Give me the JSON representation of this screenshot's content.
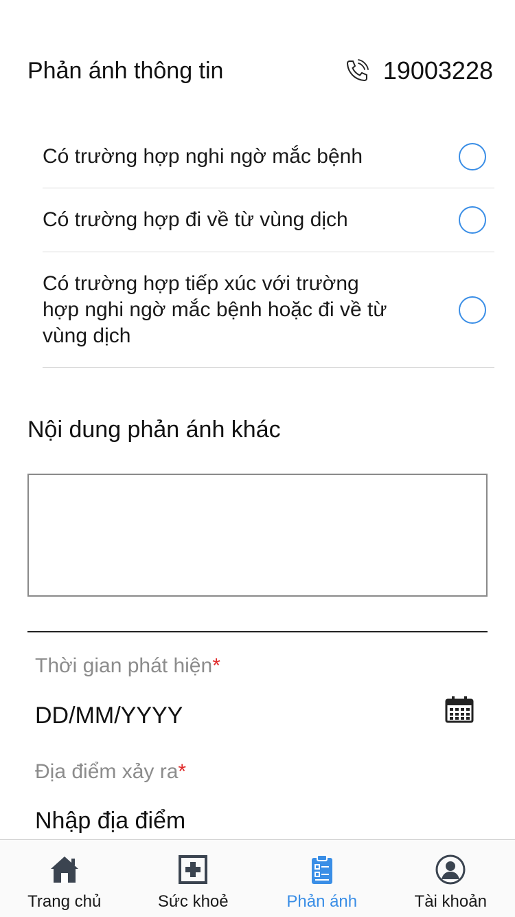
{
  "header": {
    "title": "Phản ánh thông tin",
    "hotline": "19003228",
    "hotline_icon": "phone-icon"
  },
  "options": [
    {
      "label": "Có trường hợp nghi ngờ mắc bệnh",
      "selected": false
    },
    {
      "label": "Có trường hợp đi về từ vùng dịch",
      "selected": false
    },
    {
      "label": "Có trường hợp tiếp xúc với trường hợp nghi ngờ mắc bệnh hoặc đi về từ vùng dịch",
      "selected": false
    }
  ],
  "other_content": {
    "title": "Nội dung phản ánh khác",
    "value": ""
  },
  "detection_time": {
    "label": "Thời gian phát hiện",
    "required_mark": "*",
    "value": "DD/MM/YYYY",
    "icon": "calendar-icon"
  },
  "location": {
    "label": "Địa điểm xảy ra",
    "required_mark": "*",
    "value": "Nhập địa điểm"
  },
  "tabbar": {
    "active_color": "#3a8ee6",
    "items": [
      {
        "label": "Trang chủ",
        "icon": "home-icon"
      },
      {
        "label": "Sức khoẻ",
        "icon": "health-icon"
      },
      {
        "label": "Phản ánh",
        "icon": "report-icon",
        "active": true
      },
      {
        "label": "Tài khoản",
        "icon": "account-icon"
      }
    ]
  }
}
